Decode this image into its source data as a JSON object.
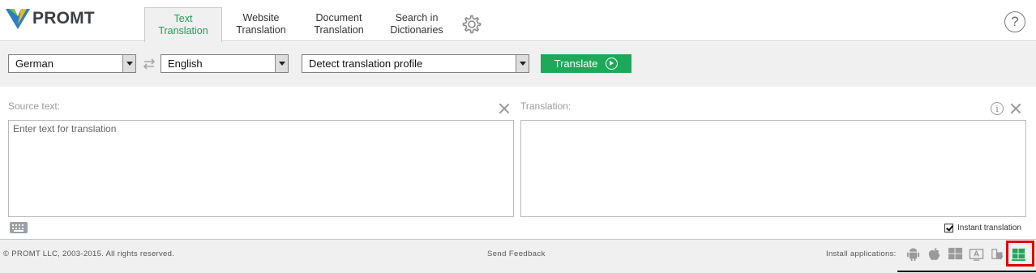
{
  "brand": {
    "name": "PROMT"
  },
  "tabs": [
    {
      "label": "Text\nTranslation",
      "active": true
    },
    {
      "label": "Website\nTranslation",
      "active": false
    },
    {
      "label": "Document\nTranslation",
      "active": false
    },
    {
      "label": "Search in\nDictionaries",
      "active": false
    }
  ],
  "help": {
    "glyph": "?"
  },
  "toolbar": {
    "source_language": "German",
    "target_language": "English",
    "profile": "Detect translation profile",
    "translate_label": "Translate"
  },
  "source": {
    "label": "Source text:",
    "placeholder": "Enter text for translation"
  },
  "translation": {
    "label": "Translation:",
    "text": ""
  },
  "instant_translation": {
    "label": "Instant translation",
    "checked": true
  },
  "footer": {
    "copyright": "© PROMT LLC, 2003-2015. All rights reserved.",
    "feedback": "Send Feedback",
    "install_label": "Install applications:",
    "apps": [
      "android-icon",
      "apple-icon",
      "windows-icon",
      "mac-app-icon",
      "mac-finder-icon",
      "windows-store-icon"
    ]
  },
  "colors": {
    "accent": "#1ea85a",
    "highlight": "#e00000",
    "toolbar_bg": "#f0f0f0"
  }
}
